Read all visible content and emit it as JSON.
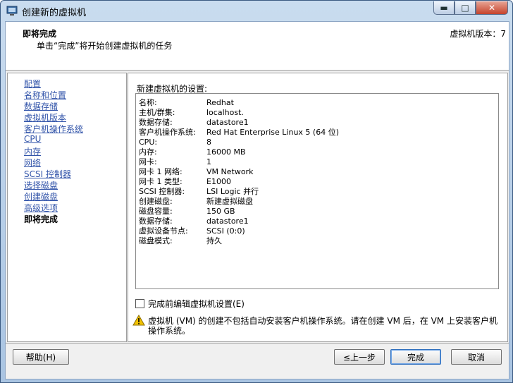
{
  "window": {
    "title": "创建新的虚拟机"
  },
  "header": {
    "title": "即将完成",
    "subtitle": "单击“完成”将开始创建虚拟机的任务",
    "version": "虚拟机版本：7"
  },
  "nav": {
    "items": [
      {
        "label": "配置"
      },
      {
        "label": "名称和位置"
      },
      {
        "label": "数据存储"
      },
      {
        "label": "虚拟机版本"
      },
      {
        "label": "客户机操作系统"
      },
      {
        "label": "CPU"
      },
      {
        "label": "内存"
      },
      {
        "label": "网络"
      },
      {
        "label": "SCSI 控制器"
      },
      {
        "label": "选择磁盘"
      },
      {
        "label": "创建磁盘"
      },
      {
        "label": "高级选项"
      },
      {
        "label": "即将完成"
      }
    ]
  },
  "settings": {
    "label": "新建虚拟机的设置:",
    "rows": [
      {
        "key": "名称:",
        "value": "Redhat"
      },
      {
        "key": "主机/群集:",
        "value": "localhost."
      },
      {
        "key": "数据存储:",
        "value": "datastore1"
      },
      {
        "key": "客户机操作系统:",
        "value": "Red Hat Enterprise Linux 5 (64 位)"
      },
      {
        "key": "CPU:",
        "value": "8"
      },
      {
        "key": "内存:",
        "value": "16000 MB"
      },
      {
        "key": "网卡:",
        "value": "1"
      },
      {
        "key": "网卡 1 网络:",
        "value": "VM Network"
      },
      {
        "key": "网卡 1 类型:",
        "value": "E1000"
      },
      {
        "key": "SCSI 控制器:",
        "value": "LSI Logic 并行"
      },
      {
        "key": "创建磁盘:",
        "value": "新建虚拟磁盘"
      },
      {
        "key": "磁盘容量:",
        "value": "150 GB"
      },
      {
        "key": "数据存储:",
        "value": "datastore1"
      },
      {
        "key": "虚拟设备节点:",
        "value": "SCSI (0:0)"
      },
      {
        "key": "磁盘模式:",
        "value": "持久"
      }
    ]
  },
  "edit_option": {
    "label": "完成前编辑虚拟机设置(E)"
  },
  "warning": {
    "text": "虚拟机 (VM) 的创建不包括自动安装客户机操作系统。请在创建 VM 后，在 VM 上安装客户机操作系统。"
  },
  "buttons": {
    "help": "帮助(H)",
    "back": "≤上一步",
    "finish": "完成",
    "cancel": "取消"
  },
  "colors": {
    "link": "#3355aa",
    "warning": "#f2c200"
  }
}
